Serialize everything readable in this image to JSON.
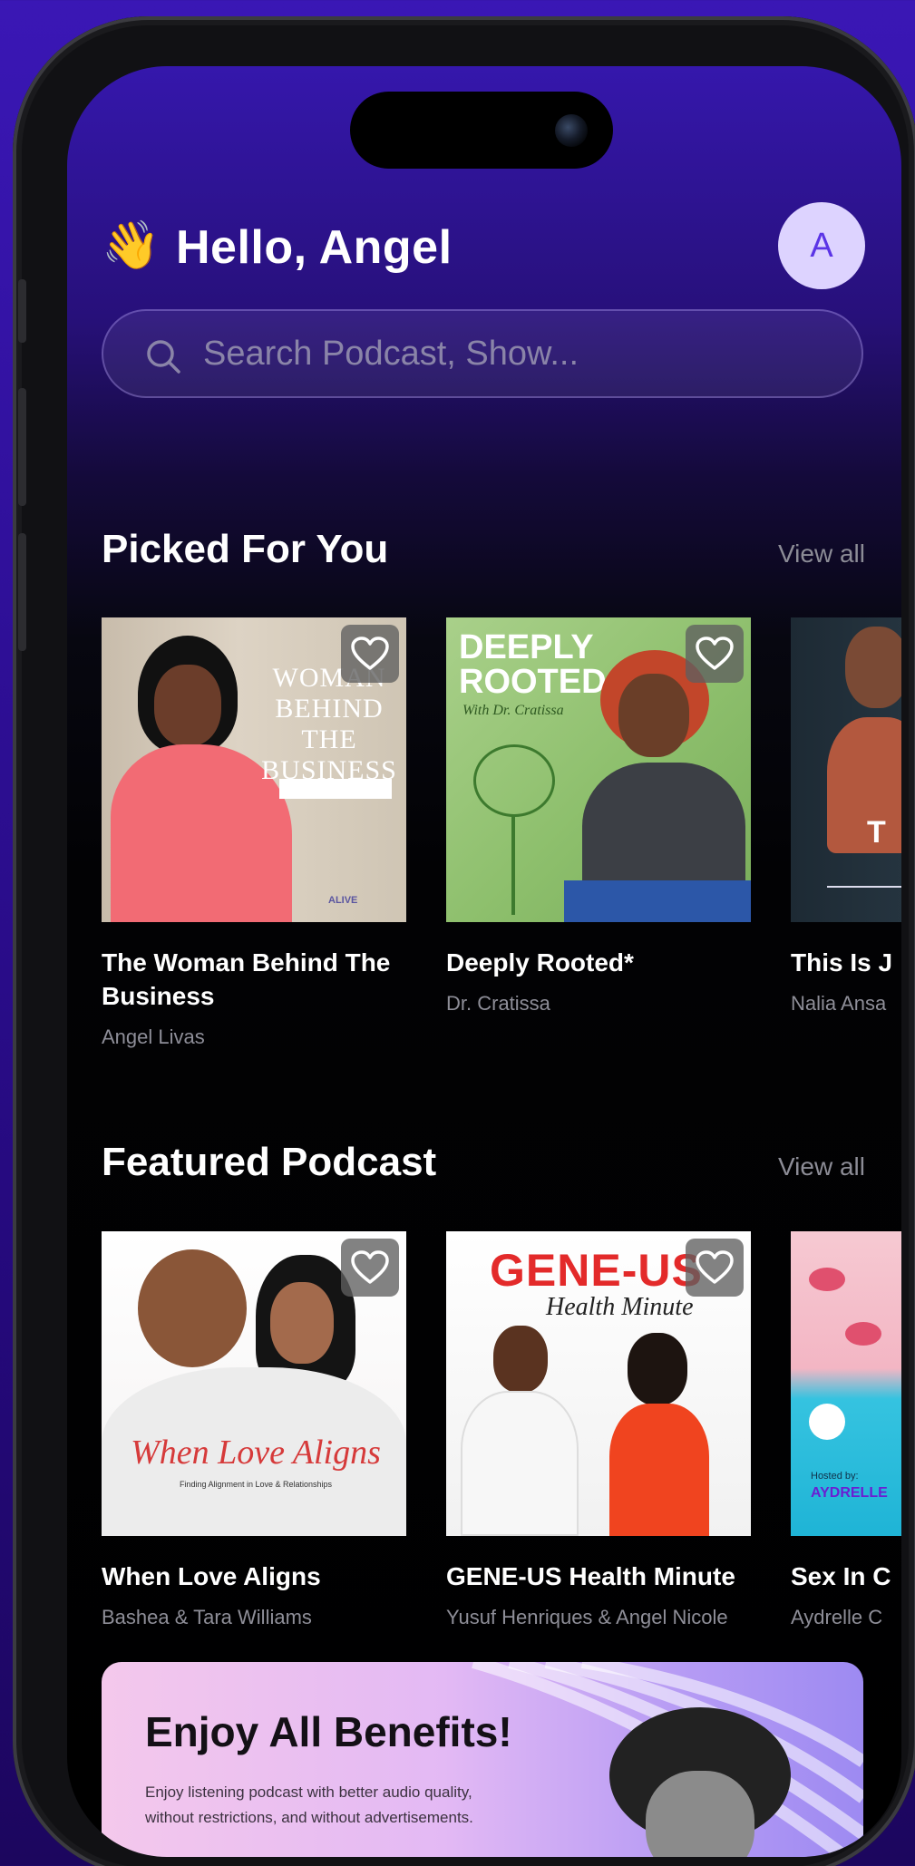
{
  "header": {
    "wave_emoji": "👋",
    "greeting": "Hello, Angel",
    "avatar_initial": "A"
  },
  "search": {
    "placeholder": "Search Podcast, Show..."
  },
  "sections": {
    "picked": {
      "title": "Picked For You",
      "view_all": "View all",
      "cards": [
        {
          "title": "The Woman Behind The Business",
          "author": "Angel Livas",
          "cover_text": "WOMAN BEHIND THE BUSINESS",
          "cover_footer": "ALIVE"
        },
        {
          "title": "Deeply Rooted*",
          "author": "Dr. Cratissa",
          "cover_text": "DEEPLY ROOTED",
          "cover_subtext": "With Dr. Cratissa"
        },
        {
          "title": "This Is J",
          "author": "Nalia Ansa",
          "cover_text": "T"
        }
      ]
    },
    "featured": {
      "title": "Featured Podcast",
      "view_all": "View all",
      "cards": [
        {
          "title": "When Love Aligns",
          "author": "Bashea & Tara Williams",
          "cover_text": "When Love Aligns",
          "cover_subtext": "Finding Alignment in Love & Relationships"
        },
        {
          "title": "GENE-US Health Minute",
          "author": "Yusuf Henriques & Angel Nicole",
          "cover_text": "GENE-US",
          "cover_subtext": "Health Minute"
        },
        {
          "title": "Sex In C",
          "author": "Aydrelle C",
          "cover_text": "AYDRELLE",
          "cover_subtext": "Hosted by:"
        }
      ]
    }
  },
  "banner": {
    "title": "Enjoy All Benefits!",
    "text": "Enjoy listening podcast with better audio quality, without restrictions, and without advertisements."
  },
  "colors": {
    "accent": "#5b34e6",
    "avatar_bg": "#ddd3ff",
    "muted_text": "#8e8e98"
  }
}
